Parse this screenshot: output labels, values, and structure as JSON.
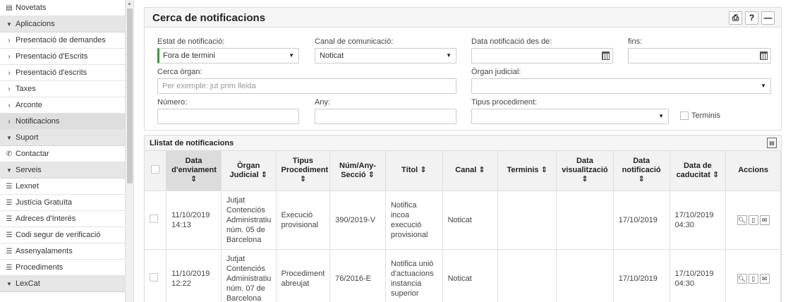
{
  "sidebar": {
    "items": [
      {
        "label": "Novetats",
        "icon": "news-icon",
        "kind": "item"
      },
      {
        "label": "Aplicacions",
        "icon": "caret-down-icon",
        "kind": "head"
      },
      {
        "label": "Presentació de demandes",
        "icon": "chevron-right-icon",
        "kind": "item"
      },
      {
        "label": "Presentació d'Escrits",
        "icon": "chevron-right-icon",
        "kind": "item"
      },
      {
        "label": "Presentació d'escrits",
        "icon": "chevron-right-icon",
        "kind": "item"
      },
      {
        "label": "Taxes",
        "icon": "chevron-right-icon",
        "kind": "item"
      },
      {
        "label": "Arconte",
        "icon": "chevron-right-icon",
        "kind": "item"
      },
      {
        "label": "Notificacions",
        "icon": "chevron-right-icon",
        "kind": "active"
      },
      {
        "label": "Suport",
        "icon": "caret-down-icon",
        "kind": "head"
      },
      {
        "label": "Contactar",
        "icon": "phone-icon",
        "kind": "item"
      },
      {
        "label": "Serveis",
        "icon": "caret-down-icon",
        "kind": "head"
      },
      {
        "label": "Lexnet",
        "icon": "list-icon",
        "kind": "item"
      },
      {
        "label": "Justícia Gratuïta",
        "icon": "list-icon",
        "kind": "item"
      },
      {
        "label": "Adreces d'Interès",
        "icon": "list-icon",
        "kind": "item"
      },
      {
        "label": "Codi segur de verificació",
        "icon": "list-icon",
        "kind": "item"
      },
      {
        "label": "Assenyalaments",
        "icon": "list-icon",
        "kind": "item"
      },
      {
        "label": "Procediments",
        "icon": "list-icon",
        "kind": "item"
      },
      {
        "label": "LexCat",
        "icon": "caret-down-icon",
        "kind": "head"
      }
    ]
  },
  "search": {
    "title": "Cerca de notificacions",
    "buttons": {
      "print": "⎙",
      "help": "?",
      "collapse": "—"
    },
    "estat_label": "Estat de notificació:",
    "estat_value": "Fora de termini",
    "canal_label": "Canal de comunicació:",
    "canal_value": "Noticat",
    "data_des_label": "Data notificació des de:",
    "data_des_value": "",
    "fins_label": "fins:",
    "fins_value": "",
    "organ_label": "Cerca òrgan:",
    "organ_placeholder": "Per exemple: jut prim lleida",
    "organ_judicial_label": "Òrgan judicial:",
    "organ_judicial_value": "",
    "numero_label": "Número:",
    "numero_value": "",
    "any_label": "Any:",
    "any_value": "",
    "tipus_label": "Tipus procediment:",
    "tipus_value": "",
    "terminis_label": "Terminis"
  },
  "list": {
    "title": "Llistat de notificacions",
    "columns": [
      {
        "label": "Data d'enviament ⇕",
        "sorted": true
      },
      {
        "label": "Òrgan Judicial ⇕",
        "sorted": false
      },
      {
        "label": "Tipus Procediment ⇕",
        "sorted": false
      },
      {
        "label": "Núm/Any-Secció ⇕",
        "sorted": false
      },
      {
        "label": "Títol ⇕",
        "sorted": false
      },
      {
        "label": "Canal ⇕",
        "sorted": false
      },
      {
        "label": "Terminis ⇕",
        "sorted": false
      },
      {
        "label": "Data visualització ⇕",
        "sorted": false
      },
      {
        "label": "Data notificació ⇕",
        "sorted": false
      },
      {
        "label": "Data de caducitat ⇕",
        "sorted": false
      },
      {
        "label": "Accions",
        "sorted": false
      }
    ],
    "rows": [
      {
        "data_enviament": "11/10/2019 14:13",
        "organ": "Jutjat Contenciós Administratiu núm. 05 de Barcelona",
        "tipus": "Execució provisional",
        "num": "390/2019-V",
        "titol": "Notifica incoa execució provisional",
        "canal": "Noticat",
        "terminis": "",
        "data_visualitzacio": "",
        "data_notificacio": "17/10/2019",
        "data_caducitat": "17/10/2019 04:30"
      },
      {
        "data_enviament": "11/10/2019 12:22",
        "organ": "Jutjat Contenciós Administratiu núm. 07 de Barcelona",
        "tipus": "Procediment abreujat",
        "num": "76/2016-E",
        "titol": "Notifica unió d'actuacions instancia superior",
        "canal": "Noticat",
        "terminis": "",
        "data_visualitzacio": "",
        "data_notificacio": "17/10/2019",
        "data_caducitat": "17/10/2019 04:30"
      }
    ]
  }
}
